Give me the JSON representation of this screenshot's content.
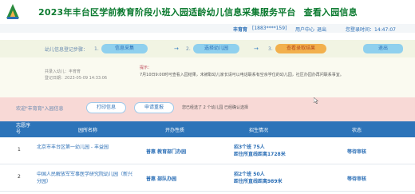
{
  "header": {
    "title": "2023年丰台区学前教育阶段小班入园适龄幼儿信息采集服务平台",
    "view_link": "查看入园信息"
  },
  "user_bar": {
    "username": "丰育育",
    "phone": "[1883****159]",
    "user_center": "用户中心",
    "logout": "退出",
    "login_time": "您登录时间：14:47:07"
  },
  "steps": {
    "label": "幼儿信息登记步骤：",
    "items": [
      {
        "num": "1.",
        "label": "信息采集"
      },
      {
        "num": "2.",
        "label": "选择幼儿园"
      },
      {
        "num": "3.",
        "label": "查看录取结果"
      }
    ],
    "exit_label": "退出"
  },
  "info": {
    "lines": [
      "共录入幼儿：丰育育",
      "登记日期：2023-05-09 14:33:06"
    ],
    "prompt_title": "提示：",
    "prompt_text": "7月10日9:00时可查看入园结果，未被取幼儿家长请可以电话联系有空余学位的幼儿园，社区办园办再问联系事宜。"
  },
  "actions": {
    "tag": "欢迎\"丰育育\"入园信息",
    "print": "打印信息",
    "apply": "申请重报",
    "selected": "您已经选了 2 个幼儿园 已经确认选择"
  },
  "table": {
    "headers": {
      "no": "志愿序号",
      "name": "园所名称",
      "type": "开办性质",
      "recruit": "招生情况",
      "status": "状态"
    },
    "rows": [
      {
        "no": "1",
        "name": "北京市丰台区第一幼儿园 - 丰益园",
        "type": "普惠 教育部门办园",
        "recruit_line1": "招3个班 75人",
        "recruit_line2": "距住所直线距离1728米",
        "status": "等待审核"
      },
      {
        "no": "2",
        "name": "中国人民解放军军事医学研究院幼儿园（新兴分园）",
        "type": "普惠 部队办园",
        "recruit_line1": "招2个班 50人",
        "recruit_line2": "距住所直线距离989米",
        "status": "等待审核"
      }
    ]
  },
  "colors": {
    "title_green": "#0b7a2f",
    "link_blue": "#2c6fb6",
    "header_blue": "#2d74b9",
    "step_blue": "#8fd0ee",
    "step_orange": "#f2b04d",
    "pink_band": "#f8d9d6"
  }
}
